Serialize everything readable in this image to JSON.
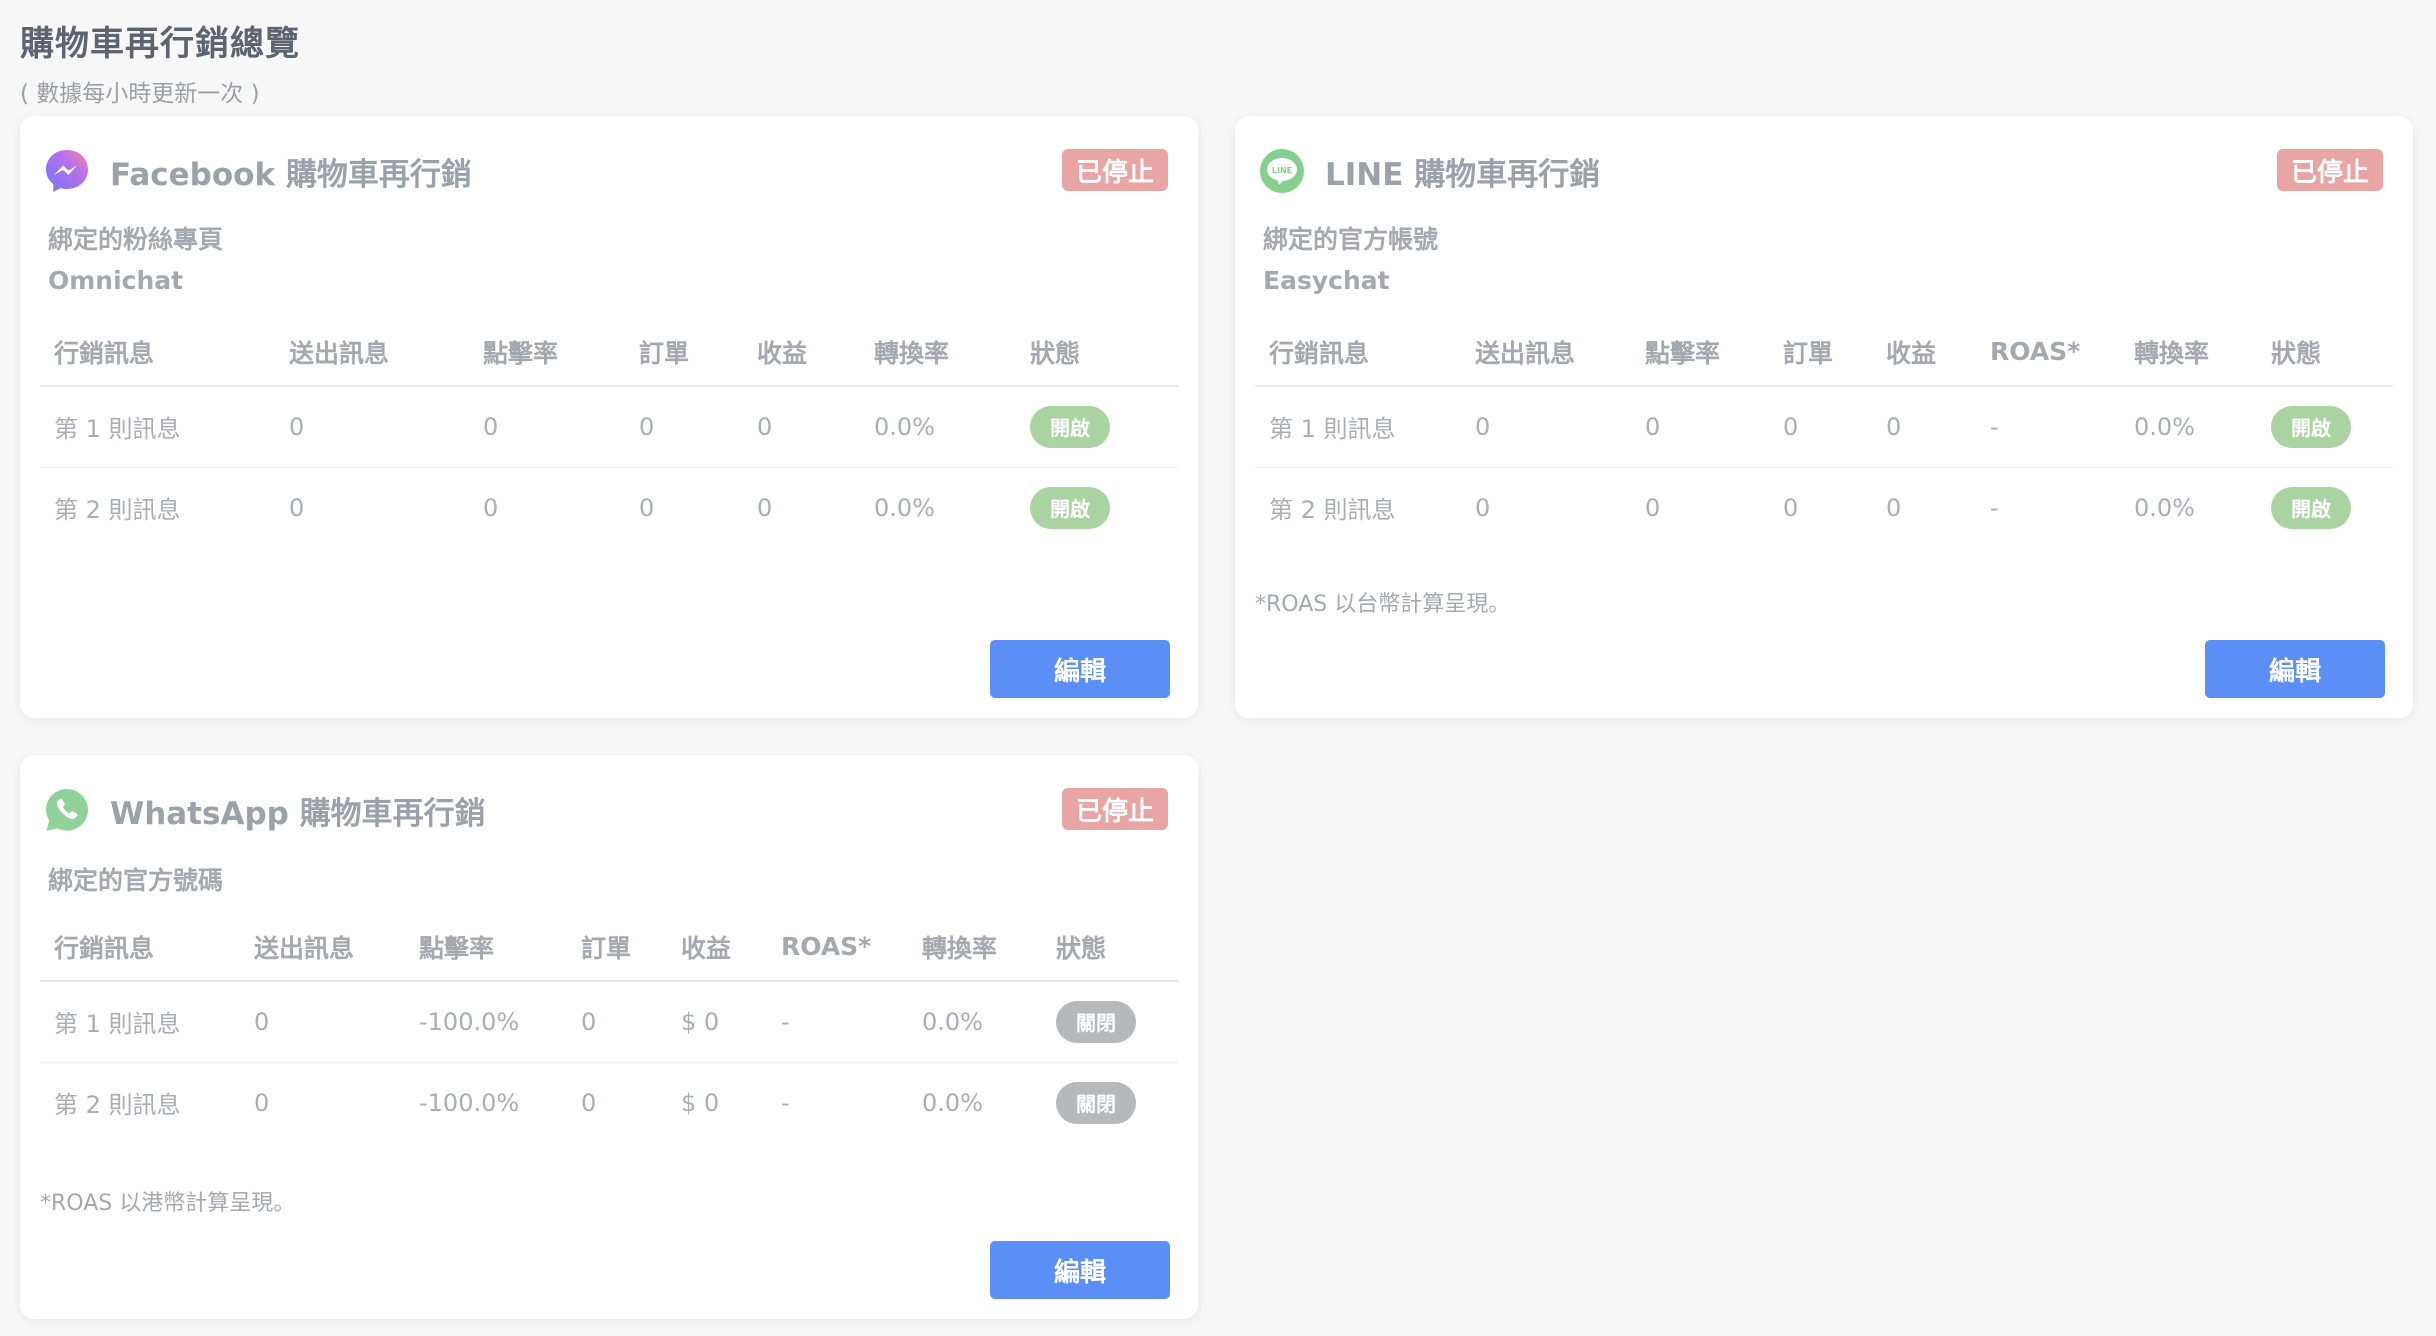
{
  "page": {
    "title": "購物車再行銷總覽",
    "subtitle": "( 數據每小時更新一次 )"
  },
  "colors": {
    "stopped_badge": "#e8a5a3",
    "toggle_on": "#a9d3a1",
    "toggle_off": "#b6b8bb",
    "edit_button": "#5b8ff5",
    "messenger_gradient": [
      "#7b6cf6",
      "#f06fa0"
    ],
    "line_green": "#4cc764",
    "whatsapp_green": "#58c36c"
  },
  "facebook": {
    "icon": "messenger-icon",
    "title": "Facebook 購物車再行銷",
    "status": "已停止",
    "bound_label": "綁定的粉絲專頁",
    "bound_value": "Omnichat",
    "columns": [
      "行銷訊息",
      "送出訊息",
      "點擊率",
      "訂單",
      "收益",
      "轉換率",
      "狀態"
    ],
    "rows": [
      {
        "name": "第 1 則訊息",
        "sent": "0",
        "ctr": "0",
        "orders": "0",
        "revenue": "0",
        "conversion": "0.0%",
        "status": "開啟"
      },
      {
        "name": "第 2 則訊息",
        "sent": "0",
        "ctr": "0",
        "orders": "0",
        "revenue": "0",
        "conversion": "0.0%",
        "status": "開啟"
      }
    ],
    "edit_label": "編輯"
  },
  "line": {
    "icon": "line-icon",
    "icon_text": "LINE",
    "title": "LINE 購物車再行銷",
    "status": "已停止",
    "bound_label": "綁定的官方帳號",
    "bound_value": "Easychat",
    "columns": [
      "行銷訊息",
      "送出訊息",
      "點擊率",
      "訂單",
      "收益",
      "ROAS*",
      "轉換率",
      "狀態"
    ],
    "rows": [
      {
        "name": "第 1 則訊息",
        "sent": "0",
        "ctr": "0",
        "orders": "0",
        "revenue": "0",
        "roas": "-",
        "conversion": "0.0%",
        "status": "開啟"
      },
      {
        "name": "第 2 則訊息",
        "sent": "0",
        "ctr": "0",
        "orders": "0",
        "revenue": "0",
        "roas": "-",
        "conversion": "0.0%",
        "status": "開啟"
      }
    ],
    "footnote": "*ROAS 以台幣計算呈現。",
    "edit_label": "編輯"
  },
  "whatsapp": {
    "icon": "whatsapp-icon",
    "title": "WhatsApp 購物車再行銷",
    "status": "已停止",
    "bound_label": "綁定的官方號碼",
    "columns": [
      "行銷訊息",
      "送出訊息",
      "點擊率",
      "訂單",
      "收益",
      "ROAS*",
      "轉換率",
      "狀態"
    ],
    "rows": [
      {
        "name": "第 1 則訊息",
        "sent": "0",
        "ctr": "-100.0%",
        "orders": "0",
        "revenue": "$ 0",
        "roas": "-",
        "conversion": "0.0%",
        "status": "關閉"
      },
      {
        "name": "第 2 則訊息",
        "sent": "0",
        "ctr": "-100.0%",
        "orders": "0",
        "revenue": "$ 0",
        "roas": "-",
        "conversion": "0.0%",
        "status": "關閉"
      }
    ],
    "footnote": "*ROAS 以港幣計算呈現。",
    "edit_label": "編輯"
  }
}
